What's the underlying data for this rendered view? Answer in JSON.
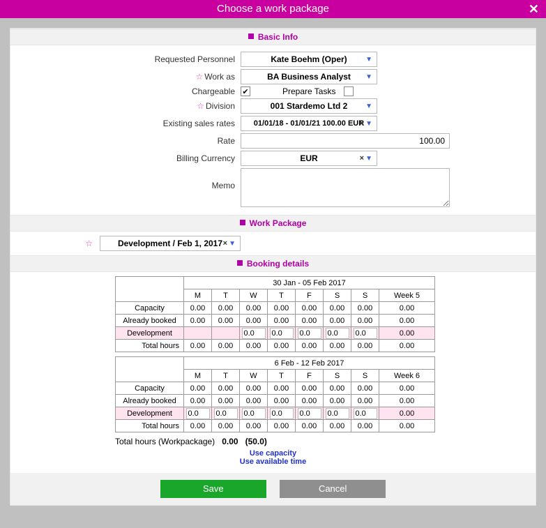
{
  "title": "Choose a work package",
  "sections": {
    "basic": "Basic Info",
    "wp": "Work Package",
    "booking": "Booking details"
  },
  "labels": {
    "reqPersonnel": "Requested Personnel",
    "workAs": "Work as",
    "chargeable": "Chargeable",
    "prepareTasks": "Prepare Tasks",
    "division": "Division",
    "existingRates": "Existing sales rates",
    "rate": "Rate",
    "billingCurrency": "Billing Currency",
    "memo": "Memo",
    "totalHours": "Total hours (Workpackage)",
    "useCapacity": "Use capacity",
    "useAvailable": "Use available time"
  },
  "values": {
    "reqPersonnel": "Kate Boehm (Oper)",
    "workAs": "BA Business Analyst",
    "chargeable": true,
    "prepareTasks": false,
    "division": "001 Stardemo Ltd 2",
    "existingRates": "01/01/18 - 01/01/21 100.00 EUR",
    "rate": "100.00",
    "billingCurrency": "EUR",
    "workPackage": "Development / Feb 1, 2017",
    "totalHoursVal": "0.00",
    "totalHoursCap": "(50.0)"
  },
  "weeks": [
    {
      "range": "30 Jan - 05 Feb 2017",
      "weekLabel": "Week 5",
      "days": [
        "M",
        "T",
        "W",
        "T",
        "F",
        "S",
        "S"
      ],
      "capacity": [
        "0.00",
        "0.00",
        "0.00",
        "0.00",
        "0.00",
        "0.00",
        "0.00",
        "0.00"
      ],
      "booked": [
        "0.00",
        "0.00",
        "0.00",
        "0.00",
        "0.00",
        "0.00",
        "0.00",
        "0.00"
      ],
      "devInputs": [
        "",
        "",
        "0.0",
        "0.0",
        "0.0",
        "0.0",
        "0.0"
      ],
      "devWeek": "0.00",
      "total": [
        "0.00",
        "0.00",
        "0.00",
        "0.00",
        "0.00",
        "0.00",
        "0.00",
        "0.00"
      ],
      "rowNames": {
        "cap": "Capacity",
        "booked": "Already booked",
        "dev": "Development",
        "tot": "Total hours"
      }
    },
    {
      "range": "6 Feb - 12 Feb 2017",
      "weekLabel": "Week 6",
      "days": [
        "M",
        "T",
        "W",
        "T",
        "F",
        "S",
        "S"
      ],
      "capacity": [
        "0.00",
        "0.00",
        "0.00",
        "0.00",
        "0.00",
        "0.00",
        "0.00",
        "0.00"
      ],
      "booked": [
        "0.00",
        "0.00",
        "0.00",
        "0.00",
        "0.00",
        "0.00",
        "0.00",
        "0.00"
      ],
      "devInputs": [
        "0.0",
        "0.0",
        "0.0",
        "0.0",
        "0.0",
        "0.0",
        "0.0"
      ],
      "devWeek": "0.00",
      "total": [
        "0.00",
        "0.00",
        "0.00",
        "0.00",
        "0.00",
        "0.00",
        "0.00",
        "0.00"
      ],
      "rowNames": {
        "cap": "Capacity",
        "booked": "Already booked",
        "dev": "Development",
        "tot": "Total hours"
      }
    }
  ],
  "buttons": {
    "save": "Save",
    "cancel": "Cancel"
  }
}
